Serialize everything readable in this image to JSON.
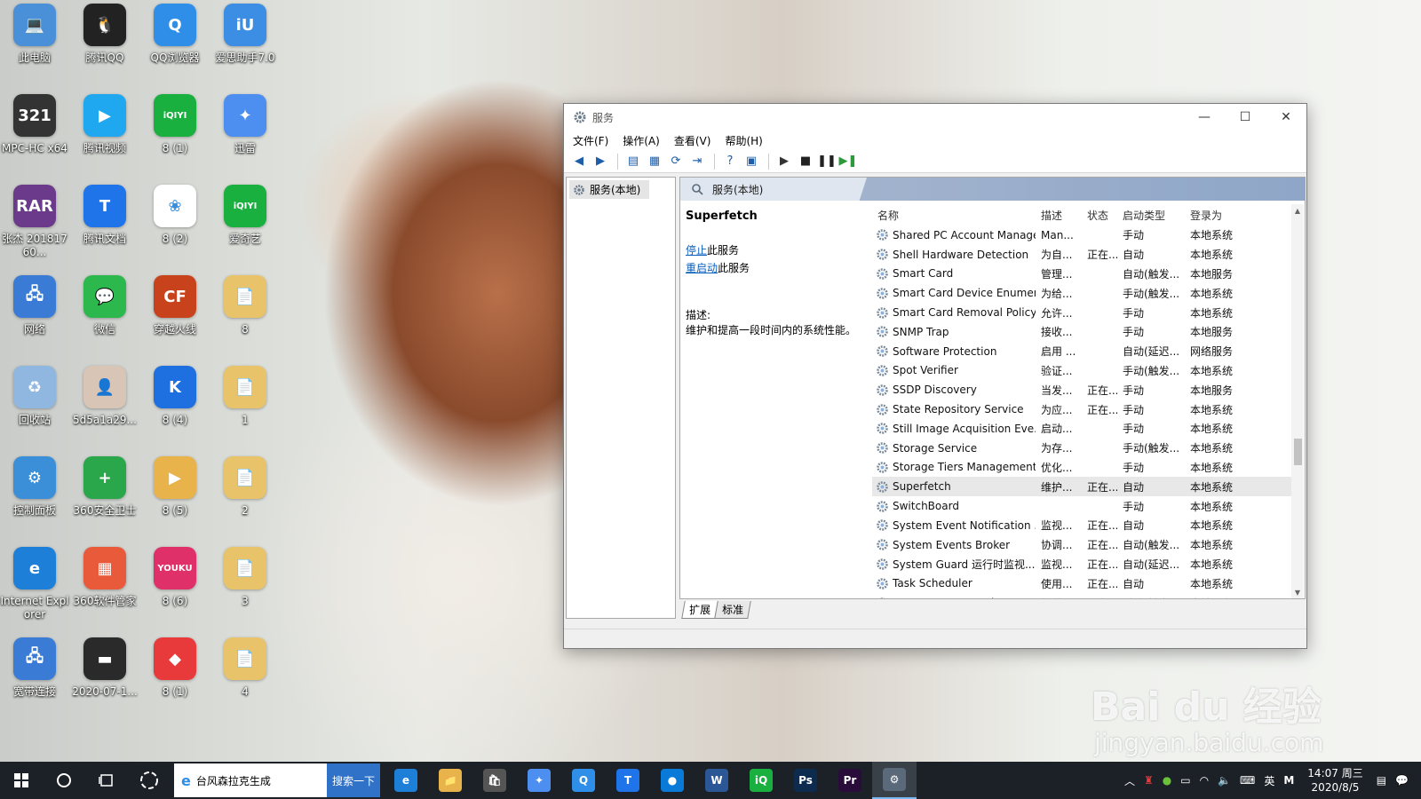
{
  "desktop_icons": [
    {
      "label": "此电脑",
      "color": "#4a90d9",
      "glyph": "💻"
    },
    {
      "label": "腾讯QQ",
      "color": "#222222",
      "glyph": "🐧"
    },
    {
      "label": "QQ浏览器",
      "color": "#2f8fe8",
      "glyph": "Q"
    },
    {
      "label": "爱思助手7.0",
      "color": "#3b8ee3",
      "glyph": "iU"
    },
    {
      "label": "MPC-HC x64",
      "color": "#333333",
      "glyph": "321"
    },
    {
      "label": "腾讯视频",
      "color": "#1fa8f0",
      "glyph": "▶"
    },
    {
      "label": "8 (1)",
      "color": "#1ab03f",
      "glyph": "iQIYI"
    },
    {
      "label": "迅雷",
      "color": "#4c8ff0",
      "glyph": "✦"
    },
    {
      "label": "张杰 20181760...",
      "color": "#6b3a8a",
      "glyph": "RAR"
    },
    {
      "label": "腾讯文档",
      "color": "#1e74e8",
      "glyph": "T"
    },
    {
      "label": "8 (2)",
      "color": "#ffffff",
      "glyph": "❀"
    },
    {
      "label": "爱奇艺",
      "color": "#1ab03f",
      "glyph": "iQIYI"
    },
    {
      "label": "网络",
      "color": "#3a7bd5",
      "glyph": "🖧"
    },
    {
      "label": "微信",
      "color": "#2db84d",
      "glyph": "💬"
    },
    {
      "label": "穿越火线",
      "color": "#c8431c",
      "glyph": "CF"
    },
    {
      "label": "8",
      "color": "#e8c36a",
      "glyph": "📄"
    },
    {
      "label": "回收站",
      "color": "#8fb7e0",
      "glyph": "♻"
    },
    {
      "label": "5d5a1a29...",
      "color": "#d9c5b5",
      "glyph": "👤"
    },
    {
      "label": "8 (4)",
      "color": "#1e6fe0",
      "glyph": "K"
    },
    {
      "label": "1",
      "color": "#e8c36a",
      "glyph": "📄"
    },
    {
      "label": "控制面板",
      "color": "#3a8fd8",
      "glyph": "⚙"
    },
    {
      "label": "360安全卫士",
      "color": "#2aa74a",
      "glyph": "+"
    },
    {
      "label": "8 (5)",
      "color": "#e8b34a",
      "glyph": "▶"
    },
    {
      "label": "2",
      "color": "#e8c36a",
      "glyph": "📄"
    },
    {
      "label": "Internet Explorer",
      "color": "#1e7fd8",
      "glyph": "e"
    },
    {
      "label": "360软件管家",
      "color": "#e85a3a",
      "glyph": "▦"
    },
    {
      "label": "8 (6)",
      "color": "#e0306a",
      "glyph": "YOUKU"
    },
    {
      "label": "3",
      "color": "#e8c36a",
      "glyph": "📄"
    },
    {
      "label": "宽带连接",
      "color": "#3a7bd5",
      "glyph": "🖧"
    },
    {
      "label": "2020-07-1...",
      "color": "#2a2a2a",
      "glyph": "▬"
    },
    {
      "label": "8 (1)",
      "color": "#e83a3a",
      "glyph": "◆"
    },
    {
      "label": "4",
      "color": "#e8c36a",
      "glyph": "📄"
    }
  ],
  "window": {
    "title": "服务",
    "controls": {
      "minimize": "—",
      "maximize": "☐",
      "close": "✕"
    },
    "menu": [
      "文件(F)",
      "操作(A)",
      "查看(V)",
      "帮助(H)"
    ],
    "tree_item": "服务(本地)",
    "pane_header": "服务(本地)",
    "selected_service": {
      "title": "Superfetch",
      "stop_link": "停止",
      "stop_suffix": "此服务",
      "restart_link": "重启动",
      "restart_suffix": "此服务",
      "desc_label": "描述:",
      "desc_text": "维护和提高一段时间内的系统性能。"
    },
    "columns": {
      "name": "名称",
      "desc": "描述",
      "status": "状态",
      "start": "启动类型",
      "logon": "登录为"
    },
    "rows": [
      {
        "name": "Shared PC Account Manager",
        "desc": "Man...",
        "status": "",
        "start": "手动",
        "logon": "本地系统"
      },
      {
        "name": "Shell Hardware Detection",
        "desc": "为自...",
        "status": "正在...",
        "start": "自动",
        "logon": "本地系统"
      },
      {
        "name": "Smart Card",
        "desc": "管理...",
        "status": "",
        "start": "自动(触发...",
        "logon": "本地服务"
      },
      {
        "name": "Smart Card Device Enumer...",
        "desc": "为给...",
        "status": "",
        "start": "手动(触发...",
        "logon": "本地系统"
      },
      {
        "name": "Smart Card Removal Policy",
        "desc": "允许...",
        "status": "",
        "start": "手动",
        "logon": "本地系统"
      },
      {
        "name": "SNMP Trap",
        "desc": "接收...",
        "status": "",
        "start": "手动",
        "logon": "本地服务"
      },
      {
        "name": "Software Protection",
        "desc": "启用 ...",
        "status": "",
        "start": "自动(延迟...",
        "logon": "网络服务"
      },
      {
        "name": "Spot Verifier",
        "desc": "验证...",
        "status": "",
        "start": "手动(触发...",
        "logon": "本地系统"
      },
      {
        "name": "SSDP Discovery",
        "desc": "当发...",
        "status": "正在...",
        "start": "手动",
        "logon": "本地服务"
      },
      {
        "name": "State Repository Service",
        "desc": "为应...",
        "status": "正在...",
        "start": "手动",
        "logon": "本地系统"
      },
      {
        "name": "Still Image Acquisition Eve...",
        "desc": "启动...",
        "status": "",
        "start": "手动",
        "logon": "本地系统"
      },
      {
        "name": "Storage Service",
        "desc": "为存...",
        "status": "",
        "start": "手动(触发...",
        "logon": "本地系统"
      },
      {
        "name": "Storage Tiers Management",
        "desc": "优化...",
        "status": "",
        "start": "手动",
        "logon": "本地系统"
      },
      {
        "name": "Superfetch",
        "desc": "维护...",
        "status": "正在...",
        "start": "自动",
        "logon": "本地系统",
        "selected": true
      },
      {
        "name": "SwitchBoard",
        "desc": "",
        "status": "",
        "start": "手动",
        "logon": "本地系统"
      },
      {
        "name": "System Event Notification ...",
        "desc": "监视...",
        "status": "正在...",
        "start": "自动",
        "logon": "本地系统"
      },
      {
        "name": "System Events Broker",
        "desc": "协调...",
        "status": "正在...",
        "start": "自动(触发...",
        "logon": "本地系统"
      },
      {
        "name": "System Guard 运行时监视...",
        "desc": "监视...",
        "status": "正在...",
        "start": "自动(延迟...",
        "logon": "本地系统"
      },
      {
        "name": "Task Scheduler",
        "desc": "使用...",
        "status": "正在...",
        "start": "自动",
        "logon": "本地系统"
      },
      {
        "name": "TCP/IP NetBIOS Helper",
        "desc": "提供...",
        "status": "正在...",
        "start": "手动(触发...",
        "logon": "本地服务"
      }
    ],
    "tabs": [
      "扩展",
      "标准"
    ]
  },
  "taskbar": {
    "search_text": "台风森拉克生成",
    "search_button": "搜索一下",
    "apps": [
      {
        "name": "edge",
        "color": "#1e7fd8",
        "glyph": "e"
      },
      {
        "name": "file-explorer",
        "color": "#e8b34a",
        "glyph": "📁"
      },
      {
        "name": "store",
        "color": "#555555",
        "glyph": "🛍"
      },
      {
        "name": "xunlei",
        "color": "#4c8ff0",
        "glyph": "✦"
      },
      {
        "name": "qq-browser",
        "color": "#2f8fe8",
        "glyph": "Q"
      },
      {
        "name": "tencent-docs",
        "color": "#1e74e8",
        "glyph": "T"
      },
      {
        "name": "tencent-meeting",
        "color": "#0a7ad8",
        "glyph": "●"
      },
      {
        "name": "word",
        "color": "#2b5797",
        "glyph": "W"
      },
      {
        "name": "iqiyi",
        "color": "#1ab03f",
        "glyph": "iQ"
      },
      {
        "name": "photoshop",
        "color": "#0d2b4f",
        "glyph": "Ps"
      },
      {
        "name": "premiere",
        "color": "#2a0c3a",
        "glyph": "Pr"
      },
      {
        "name": "services",
        "color": "#5a6a7a",
        "glyph": "⚙"
      }
    ],
    "ime": "英",
    "ime_mode": "M",
    "time": "14:07 周三",
    "date": "2020/8/5",
    "notification_count": "1"
  },
  "watermark": {
    "big": "Bai du 经验",
    "small": "jingyan.baidu.com"
  }
}
